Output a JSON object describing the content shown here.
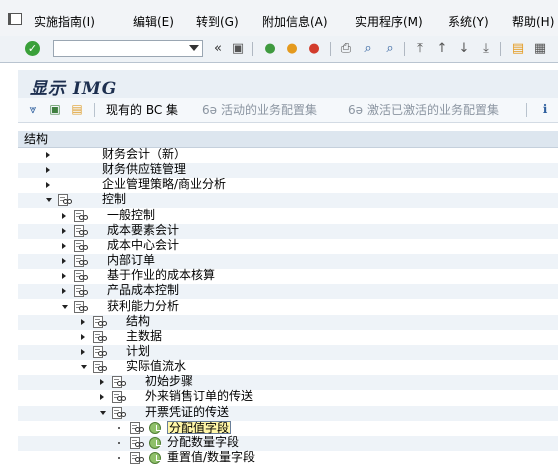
{
  "menubar": {
    "items": [
      {
        "label": "实施指南(I)",
        "key": "I"
      },
      {
        "label": "编辑(E)",
        "key": "E"
      },
      {
        "label": "转到(G)",
        "key": "G"
      },
      {
        "label": "附加信息(A)",
        "key": "A"
      },
      {
        "label": "实用程序(M)",
        "key": "M"
      },
      {
        "label": "系统(Y)",
        "key": "Y"
      },
      {
        "label": "帮助(H)",
        "key": "H"
      }
    ]
  },
  "toolbar": {
    "command_value": "",
    "collapse_glyph": "«"
  },
  "title": "显示 IMG",
  "app_toolbar": {
    "existing_bc_sets": "现有的 BC 集",
    "active_bc_sets": "活动的业务配置集",
    "activated_bc_sets": "激活已激活的业务配置集"
  },
  "tree": {
    "header": "结构",
    "rows": [
      {
        "label": "财务会计（新）",
        "level": 0,
        "toggle": "collapsed",
        "doc": false,
        "glasses": false,
        "clock": false
      },
      {
        "label": "财务供应链管理",
        "level": 0,
        "toggle": "collapsed",
        "doc": false,
        "glasses": false,
        "clock": false
      },
      {
        "label": "企业管理策略/商业分析",
        "level": 0,
        "toggle": "collapsed",
        "doc": false,
        "glasses": false,
        "clock": false
      },
      {
        "label": "控制",
        "level": 0,
        "toggle": "expanded",
        "doc": true,
        "glasses": true,
        "clock": false
      },
      {
        "label": "一般控制",
        "level": 1,
        "toggle": "collapsed",
        "doc": true,
        "glasses": true,
        "clock": false
      },
      {
        "label": "成本要素会计",
        "level": 1,
        "toggle": "collapsed",
        "doc": true,
        "glasses": true,
        "clock": false
      },
      {
        "label": "成本中心会计",
        "level": 1,
        "toggle": "collapsed",
        "doc": true,
        "glasses": true,
        "clock": false
      },
      {
        "label": "内部订单",
        "level": 1,
        "toggle": "collapsed",
        "doc": true,
        "glasses": true,
        "clock": false
      },
      {
        "label": "基于作业的成本核算",
        "level": 1,
        "toggle": "collapsed",
        "doc": true,
        "glasses": true,
        "clock": false
      },
      {
        "label": "产品成本控制",
        "level": 1,
        "toggle": "collapsed",
        "doc": true,
        "glasses": true,
        "clock": false
      },
      {
        "label": "获利能力分析",
        "level": 1,
        "toggle": "expanded",
        "doc": true,
        "glasses": true,
        "clock": false
      },
      {
        "label": "结构",
        "level": 2,
        "toggle": "collapsed",
        "doc": true,
        "glasses": true,
        "clock": false
      },
      {
        "label": "主数据",
        "level": 2,
        "toggle": "collapsed",
        "doc": true,
        "glasses": true,
        "clock": false
      },
      {
        "label": "计划",
        "level": 2,
        "toggle": "collapsed",
        "doc": true,
        "glasses": true,
        "clock": false
      },
      {
        "label": "实际值流水",
        "level": 2,
        "toggle": "expanded",
        "doc": true,
        "glasses": true,
        "clock": false
      },
      {
        "label": "初始步骤",
        "level": 3,
        "toggle": "collapsed",
        "doc": true,
        "glasses": true,
        "clock": false
      },
      {
        "label": "外来销售订单的传送",
        "level": 3,
        "toggle": "collapsed",
        "doc": true,
        "glasses": true,
        "clock": false
      },
      {
        "label": "开票凭证的传送",
        "level": 3,
        "toggle": "expanded",
        "doc": true,
        "glasses": true,
        "clock": false
      },
      {
        "label": "分配值字段",
        "level": 4,
        "toggle": "leaf",
        "doc": true,
        "glasses": true,
        "clock": true,
        "selected": true
      },
      {
        "label": "分配数量字段",
        "level": 4,
        "toggle": "leaf",
        "doc": true,
        "glasses": true,
        "clock": true
      },
      {
        "label": "重置值/数量字段",
        "level": 4,
        "toggle": "leaf",
        "doc": true,
        "glasses": true,
        "clock": true
      }
    ]
  }
}
